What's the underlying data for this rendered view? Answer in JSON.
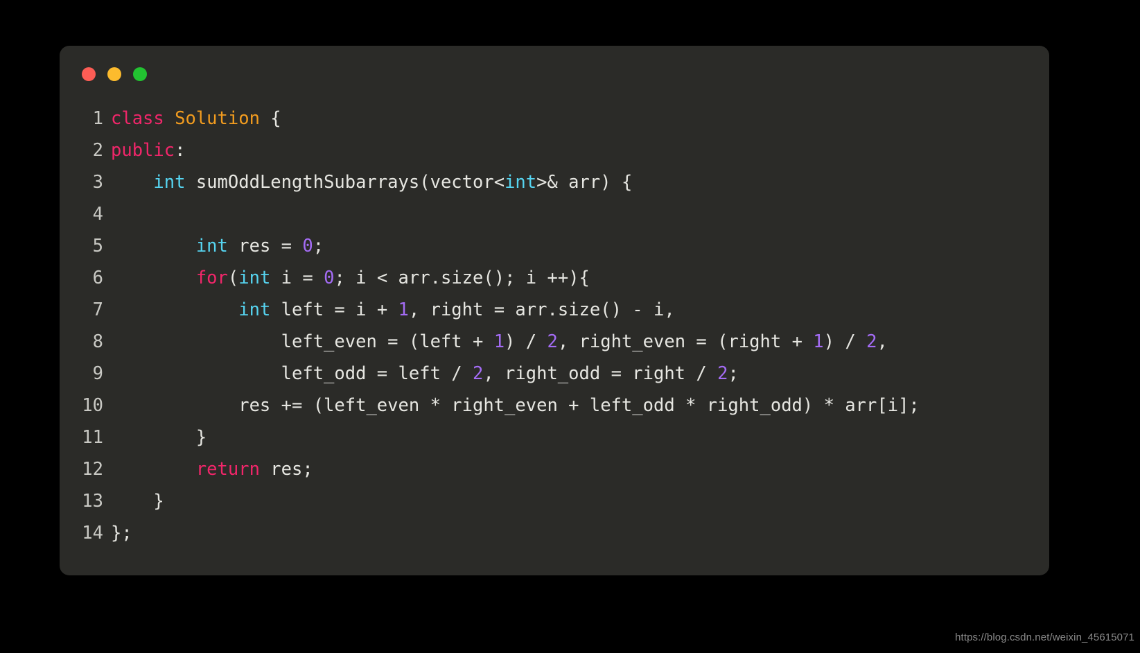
{
  "window": {
    "controls": [
      {
        "name": "close",
        "color": "#fc5d55"
      },
      {
        "name": "minimize",
        "color": "#fcbb2d"
      },
      {
        "name": "maximize",
        "color": "#22c331"
      }
    ]
  },
  "theme": {
    "page_background": "#000000",
    "window_background": "#2b2b28",
    "default_text": "#e6e6e1",
    "line_number": "#c9c9c4",
    "keyword": "#f1266a",
    "type": "#56d4f0",
    "class_name": "#f29c1f",
    "number": "#a46cf5",
    "watermark": "#8a8a8a"
  },
  "code": {
    "language": "cpp",
    "lines": [
      {
        "number": "1",
        "plain": "class Solution {",
        "tokens": [
          {
            "t": "class",
            "c": "kw"
          },
          {
            "t": " ",
            "c": "txt"
          },
          {
            "t": "Solution",
            "c": "cls"
          },
          {
            "t": " {",
            "c": "txt"
          }
        ]
      },
      {
        "number": "2",
        "plain": "public:",
        "tokens": [
          {
            "t": "public",
            "c": "kw"
          },
          {
            "t": ":",
            "c": "txt"
          }
        ]
      },
      {
        "number": "3",
        "plain": "    int sumOddLengthSubarrays(vector<int>& arr) {",
        "tokens": [
          {
            "t": "    ",
            "c": "txt"
          },
          {
            "t": "int",
            "c": "type"
          },
          {
            "t": " sumOddLengthSubarrays(vector<",
            "c": "txt"
          },
          {
            "t": "int",
            "c": "type"
          },
          {
            "t": ">& arr) {",
            "c": "txt"
          }
        ]
      },
      {
        "number": "4",
        "plain": "",
        "tokens": []
      },
      {
        "number": "5",
        "plain": "        int res = 0;",
        "tokens": [
          {
            "t": "        ",
            "c": "txt"
          },
          {
            "t": "int",
            "c": "type"
          },
          {
            "t": " res = ",
            "c": "txt"
          },
          {
            "t": "0",
            "c": "num"
          },
          {
            "t": ";",
            "c": "txt"
          }
        ]
      },
      {
        "number": "6",
        "plain": "        for(int i = 0; i < arr.size(); i ++){",
        "tokens": [
          {
            "t": "        ",
            "c": "txt"
          },
          {
            "t": "for",
            "c": "kw"
          },
          {
            "t": "(",
            "c": "txt"
          },
          {
            "t": "int",
            "c": "type"
          },
          {
            "t": " i = ",
            "c": "txt"
          },
          {
            "t": "0",
            "c": "num"
          },
          {
            "t": "; i < arr.size(); i ++){",
            "c": "txt"
          }
        ]
      },
      {
        "number": "7",
        "plain": "            int left = i + 1, right = arr.size() - i,",
        "tokens": [
          {
            "t": "            ",
            "c": "txt"
          },
          {
            "t": "int",
            "c": "type"
          },
          {
            "t": " left = i + ",
            "c": "txt"
          },
          {
            "t": "1",
            "c": "num"
          },
          {
            "t": ", right = arr.size() - i,",
            "c": "txt"
          }
        ]
      },
      {
        "number": "8",
        "plain": "                left_even = (left + 1) / 2, right_even = (right + 1) / 2,",
        "tokens": [
          {
            "t": "                left_even = (left + ",
            "c": "txt"
          },
          {
            "t": "1",
            "c": "num"
          },
          {
            "t": ") / ",
            "c": "txt"
          },
          {
            "t": "2",
            "c": "num"
          },
          {
            "t": ", right_even = (right + ",
            "c": "txt"
          },
          {
            "t": "1",
            "c": "num"
          },
          {
            "t": ") / ",
            "c": "txt"
          },
          {
            "t": "2",
            "c": "num"
          },
          {
            "t": ",",
            "c": "txt"
          }
        ]
      },
      {
        "number": "9",
        "plain": "                left_odd = left / 2, right_odd = right / 2;",
        "tokens": [
          {
            "t": "                left_odd = left / ",
            "c": "txt"
          },
          {
            "t": "2",
            "c": "num"
          },
          {
            "t": ", right_odd = right / ",
            "c": "txt"
          },
          {
            "t": "2",
            "c": "num"
          },
          {
            "t": ";",
            "c": "txt"
          }
        ]
      },
      {
        "number": "10",
        "plain": "            res += (left_even * right_even + left_odd * right_odd) * arr[i];",
        "tokens": [
          {
            "t": "            res += (left_even * right_even + left_odd * right_odd) * arr[i];",
            "c": "txt"
          }
        ]
      },
      {
        "number": "11",
        "plain": "        }",
        "tokens": [
          {
            "t": "        }",
            "c": "txt"
          }
        ]
      },
      {
        "number": "12",
        "plain": "        return res;",
        "tokens": [
          {
            "t": "        ",
            "c": "txt"
          },
          {
            "t": "return",
            "c": "kw"
          },
          {
            "t": " res;",
            "c": "txt"
          }
        ]
      },
      {
        "number": "13",
        "plain": "    }",
        "tokens": [
          {
            "t": "    }",
            "c": "txt"
          }
        ]
      },
      {
        "number": "14",
        "plain": "};",
        "tokens": [
          {
            "t": "};",
            "c": "txt"
          }
        ]
      }
    ]
  },
  "watermark": {
    "text": "https://blog.csdn.net/weixin_45615071"
  }
}
